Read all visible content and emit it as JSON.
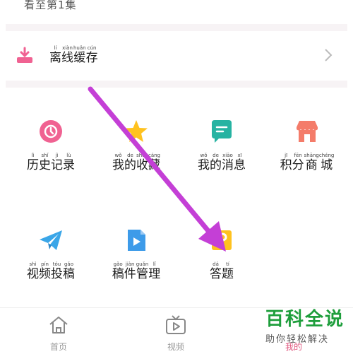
{
  "top": {
    "cut_text": "看至第1集"
  },
  "offline": {
    "label": [
      {
        "py": "lí",
        "hz": "离"
      },
      {
        "py": "xiàn",
        "hz": "线"
      },
      {
        "py": "huǎn",
        "hz": "缓"
      },
      {
        "py": "cún",
        "hz": "存"
      }
    ]
  },
  "grid": [
    {
      "name": "history",
      "color": "#f06292",
      "icon": "clock-icon",
      "label": [
        {
          "py": "lì",
          "hz": "历"
        },
        {
          "py": "shǐ",
          "hz": "史"
        },
        {
          "py": "jì",
          "hz": "记"
        },
        {
          "py": "lù",
          "hz": "录"
        }
      ]
    },
    {
      "name": "favorites",
      "color": "#ffc21f",
      "icon": "star-icon",
      "label": [
        {
          "py": "wǒ",
          "hz": "我"
        },
        {
          "py": "de",
          "hz": "的"
        },
        {
          "py": "shōu",
          "hz": "收"
        },
        {
          "py": "cáng",
          "hz": "藏"
        }
      ]
    },
    {
      "name": "messages",
      "color": "#26b3a2",
      "icon": "message-icon",
      "label": [
        {
          "py": "wǒ",
          "hz": "我"
        },
        {
          "py": "de",
          "hz": "的"
        },
        {
          "py": "xiāo",
          "hz": "消"
        },
        {
          "py": "xī",
          "hz": "息"
        }
      ]
    },
    {
      "name": "points-mall",
      "color": "#f47c6a",
      "icon": "shop-icon",
      "label": [
        {
          "py": "jī",
          "hz": "积"
        },
        {
          "py": "fēn",
          "hz": "分"
        },
        {
          "py": "shāng",
          "hz": "商"
        },
        {
          "py": "chéng",
          "hz": "城"
        }
      ]
    },
    {
      "name": "video-submit",
      "color": "#3aa6e8",
      "icon": "paper-plane-icon",
      "label": [
        {
          "py": "shì",
          "hz": "视"
        },
        {
          "py": "pín",
          "hz": "频"
        },
        {
          "py": "tóu",
          "hz": "投"
        },
        {
          "py": "gǎo",
          "hz": "稿"
        }
      ]
    },
    {
      "name": "drafts-manage",
      "color": "#3d9be9",
      "icon": "video-file-icon",
      "label": [
        {
          "py": "gǎo",
          "hz": "稿"
        },
        {
          "py": "jiàn",
          "hz": "件"
        },
        {
          "py": "guǎn",
          "hz": "管"
        },
        {
          "py": "lǐ",
          "hz": "理"
        }
      ]
    },
    {
      "name": "quiz",
      "color": "#ffc21f",
      "icon": "quiz-icon",
      "label": [
        {
          "py": "dá",
          "hz": "答"
        },
        {
          "py": "tí",
          "hz": "题"
        }
      ]
    }
  ],
  "tabs": [
    {
      "name": "home",
      "label": "首页",
      "icon": "home-icon"
    },
    {
      "name": "video",
      "label": "视频",
      "icon": "tv-icon"
    },
    {
      "name": "me",
      "label": "我的",
      "icon": "user-icon"
    }
  ],
  "watermark": {
    "title": "百科全说",
    "subtitle": "助你轻松解决"
  },
  "colors": {
    "accent": "#f06292",
    "annotation_arrow": "#c43fd6",
    "watermark": "#1e9e3c"
  }
}
